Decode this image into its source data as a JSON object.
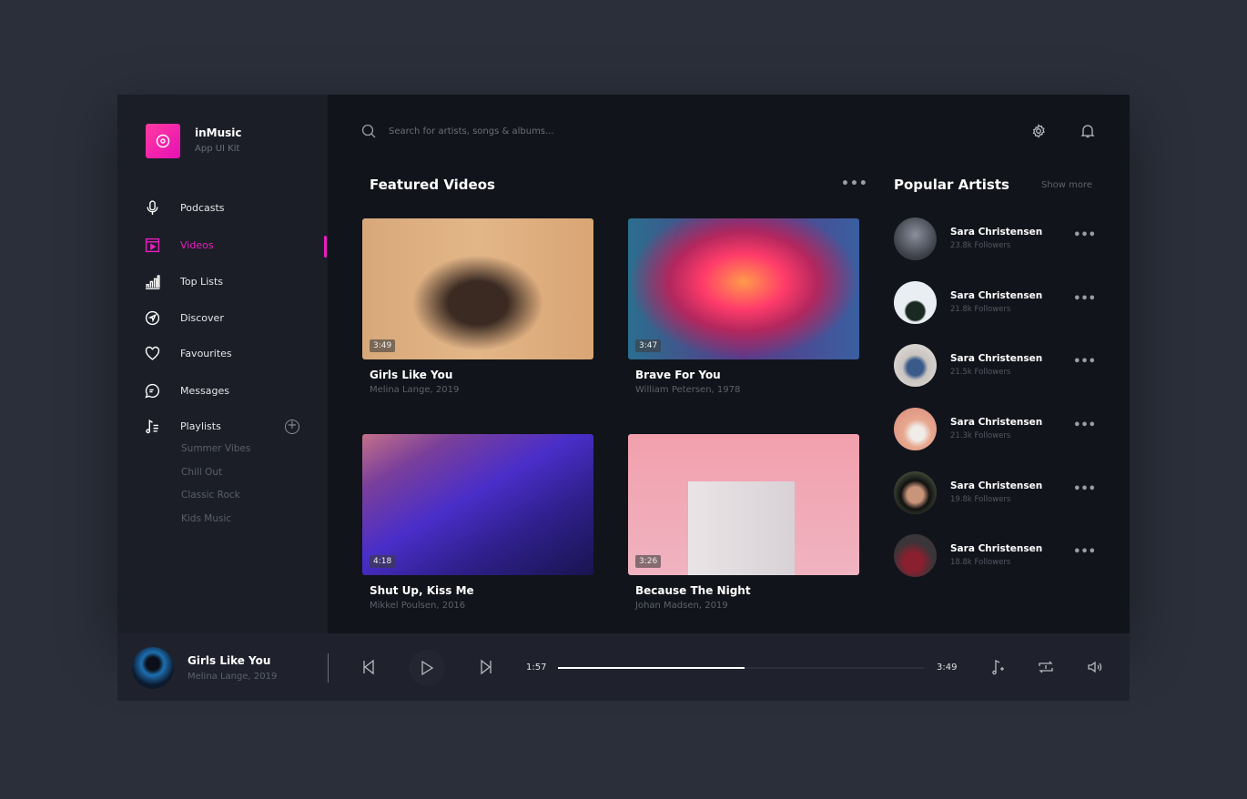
{
  "brand": {
    "name": "inMusic",
    "subtitle": "App UI Kit",
    "accent": "#e91ec1"
  },
  "sidebar": {
    "items": [
      {
        "label": "Podcasts",
        "icon": "microphone-icon"
      },
      {
        "label": "Videos",
        "icon": "video-icon",
        "active": true
      },
      {
        "label": "Top Lists",
        "icon": "bar-chart-icon"
      },
      {
        "label": "Discover",
        "icon": "compass-icon"
      },
      {
        "label": "Favourites",
        "icon": "heart-icon"
      },
      {
        "label": "Messages",
        "icon": "chat-icon"
      }
    ],
    "playlists_label": "Playlists",
    "playlists": [
      "Summer Vibes",
      "Chill Out",
      "Classic Rock",
      "Kids Music"
    ]
  },
  "search": {
    "placeholder": "Search for artists, songs & albums..."
  },
  "featured": {
    "title": "Featured Videos",
    "videos": [
      {
        "title": "Girls Like You",
        "subtitle": "Melina Lange, 2019",
        "duration": "3:49"
      },
      {
        "title": "Brave For You",
        "subtitle": "William Petersen, 1978",
        "duration": "3:47"
      },
      {
        "title": "Shut Up, Kiss Me",
        "subtitle": "Mikkel Poulsen, 2016",
        "duration": "4:18"
      },
      {
        "title": "Because The Night",
        "subtitle": "Johan Madsen, 2019",
        "duration": "3:26"
      }
    ]
  },
  "artists": {
    "title": "Popular Artists",
    "show_more": "Show more",
    "items": [
      {
        "name": "Sara Christensen",
        "followers": "23.8k Followers"
      },
      {
        "name": "Sara Christensen",
        "followers": "21.8k Followers"
      },
      {
        "name": "Sara Christensen",
        "followers": "21.5k Followers"
      },
      {
        "name": "Sara Christensen",
        "followers": "21.3k Followers"
      },
      {
        "name": "Sara Christensen",
        "followers": "19.8k Followers"
      },
      {
        "name": "Sara Christensen",
        "followers": "18.8k Followers"
      }
    ]
  },
  "player": {
    "title": "Girls Like You",
    "subtitle": "Melina Lange, 2019",
    "elapsed": "1:57",
    "total": "3:49",
    "progress": 0.51
  }
}
